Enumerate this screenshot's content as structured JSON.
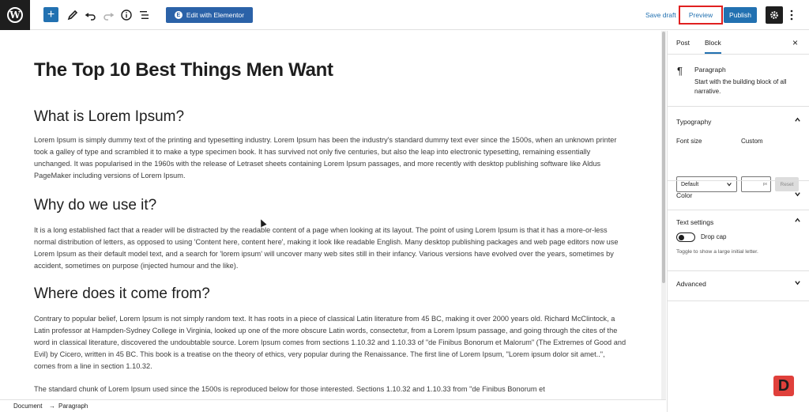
{
  "toolbar": {
    "add_icon": "+",
    "elementor_label": "Edit with Elementor",
    "save_draft_label": "Save draft",
    "preview_label": "Preview",
    "publish_label": "Publish",
    "accent_color": "#2271b1",
    "highlight_color": "#e02020"
  },
  "editor": {
    "post_title": "The Top 10 Best Things Men Want",
    "sections": [
      {
        "heading": "What is Lorem Ipsum?",
        "paragraph": "Lorem Ipsum is simply dummy text of the printing and typesetting industry. Lorem Ipsum has been the industry's standard dummy text ever since the 1500s, when an unknown printer took a galley of type and scrambled it to make a type specimen book. It has survived not only five centuries, but also the leap into electronic typesetting, remaining essentially unchanged. It was popularised in the 1960s with the release of Letraset sheets containing Lorem Ipsum passages, and more recently with desktop publishing software like Aldus PageMaker including versions of Lorem Ipsum."
      },
      {
        "heading": "Why do we use it?",
        "paragraph": "It is a long established fact that a reader will be distracted by the readable content of a page when looking at its layout. The point of using Lorem Ipsum is that it has a more-or-less normal distribution of letters, as opposed to using 'Content here, content here', making it look like readable English. Many desktop publishing packages and web page editors now use Lorem Ipsum as their default model text, and a search for 'lorem ipsum' will uncover many web sites still in their infancy. Various versions have evolved over the years, sometimes by accident, sometimes on purpose (injected humour and the like)."
      },
      {
        "heading": "Where does it come from?",
        "paragraph": "Contrary to popular belief, Lorem Ipsum is not simply random text. It has roots in a piece of classical Latin literature from 45 BC, making it over 2000 years old. Richard McClintock, a Latin professor at Hampden-Sydney College in Virginia, looked up one of the more obscure Latin words, consectetur, from a Lorem Ipsum passage, and going through the cites of the word in classical literature, discovered the undoubtable source. Lorem Ipsum comes from sections 1.10.32 and 1.10.33 of \"de Finibus Bonorum et Malorum\" (The Extremes of Good and Evil) by Cicero, written in 45 BC. This book is a treatise on the theory of ethics, very popular during the Renaissance. The first line of Lorem Ipsum, \"Lorem ipsum dolor sit amet..\", comes from a line in section 1.10.32."
      }
    ],
    "extra_paragraph": "The standard chunk of Lorem Ipsum used since the 1500s is reproduced below for those interested. Sections 1.10.32 and 1.10.33 from \"de Finibus Bonorum et"
  },
  "sidebar": {
    "tabs": [
      "Post",
      "Block"
    ],
    "active_tab": "Block",
    "close_icon": "×",
    "block": {
      "icon": "¶",
      "name": "Paragraph",
      "description": "Start with the building block of all narrative."
    },
    "typography": {
      "title": "Typography",
      "font_size_label": "Font size",
      "font_size_value": "Default",
      "custom_label": "Custom",
      "custom_unit": "px",
      "reset_label": "Reset"
    },
    "color": {
      "title": "Color"
    },
    "text_settings": {
      "title": "Text settings",
      "drop_cap_label": "Drop cap",
      "drop_cap_on": false,
      "drop_cap_help": "Toggle to show a large initial letter."
    },
    "advanced": {
      "title": "Advanced"
    }
  },
  "footer": {
    "breadcrumb": [
      "Document",
      "Paragraph"
    ],
    "separator": "→"
  },
  "brand_badge": "D"
}
